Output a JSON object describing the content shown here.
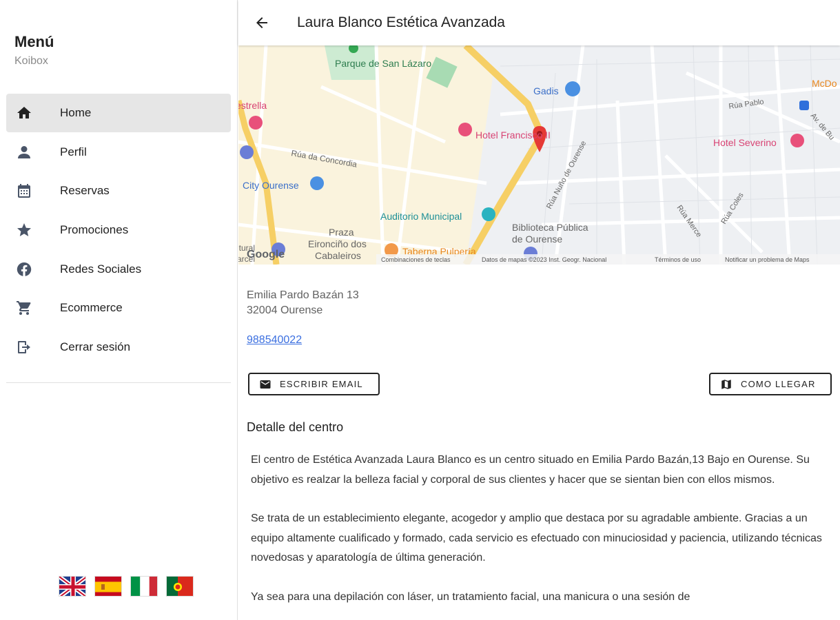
{
  "sidebar": {
    "title": "Menú",
    "subtitle": "Koibox",
    "items": [
      {
        "label": "Home",
        "icon": "home-icon"
      },
      {
        "label": "Perfil",
        "icon": "person-icon"
      },
      {
        "label": "Reservas",
        "icon": "calendar-icon"
      },
      {
        "label": "Promociones",
        "icon": "star-icon"
      },
      {
        "label": "Redes Sociales",
        "icon": "facebook-icon"
      },
      {
        "label": "Ecommerce",
        "icon": "cart-icon"
      },
      {
        "label": "Cerrar sesión",
        "icon": "logout-icon"
      }
    ],
    "flags": [
      "uk-flag-icon",
      "spain-flag-icon",
      "italy-flag-icon",
      "portugal-flag-icon"
    ]
  },
  "header": {
    "title": "Laura Blanco Estética Avanzada"
  },
  "map": {
    "labels": {
      "park": "Parque de San Lázaro",
      "gadis": "Gadis",
      "mcdo": "McDo",
      "estrella": "estrella",
      "ria_pablo": "Rúa Pablo",
      "av_bu": "Av. de Bu",
      "hotel_francisco": "Hotel Francisco II",
      "hotel_severino": "Hotel Severino",
      "concordia": "Rúa da Concordia",
      "nuno": "Rúa Nuño de Ourense",
      "city_ourense": "City Ourense",
      "auditorio": "Auditorio Municipal",
      "biblioteca_1": "Biblioteca Pública",
      "biblioteca_2": "de Ourense",
      "praza_1": "Praza",
      "praza_2": "Eironciño dos",
      "praza_3": "Cabaleiros",
      "taberna": "Taberna Pulpería",
      "rua_merce": "Rúa Merce",
      "rua_coles": "Rúa Coles",
      "cultural_1": "ltural",
      "cultural_2": "arcel",
      "google": "Google",
      "footer_keys": "Combinaciones de teclas",
      "footer_data": "Datos de mapas ©2023 Inst. Geogr. Nacional",
      "footer_terms": "Términos de uso",
      "footer_report": "Notificar un problema de Maps"
    }
  },
  "details": {
    "address_line1": "Emilia Pardo Bazán 13",
    "address_line2": "32004 Ourense",
    "phone": "988540022",
    "email_button": "ESCRIBIR EMAIL",
    "route_button": "COMO LLEGAR",
    "section_title": "Detalle del centro",
    "paragraphs": [
      "El centro de Estética Avanzada Laura Blanco es un centro situado en Emilia Pardo Bazán,13 Bajo en Ourense. Su objetivo es realzar la belleza facial y corporal de sus clientes y hacer que se sientan bien con ellos mismos.",
      "Se trata de un establecimiento elegante, acogedor y amplio que destaca por su agradable ambiente. Gracias a un equipo altamente cualificado y formado, cada servicio es efectuado con minuciosidad y paciencia, utilizando técnicas novedosas y aparatología de última generación.",
      "Ya sea para una depilación con láser, un tratamiento facial, una manicura o una sesión de"
    ]
  },
  "colors": {
    "accent": "#3b6fe0",
    "active_bg": "#e6e6e6",
    "road_major": "#f6cf65",
    "pin": "#e53935"
  }
}
